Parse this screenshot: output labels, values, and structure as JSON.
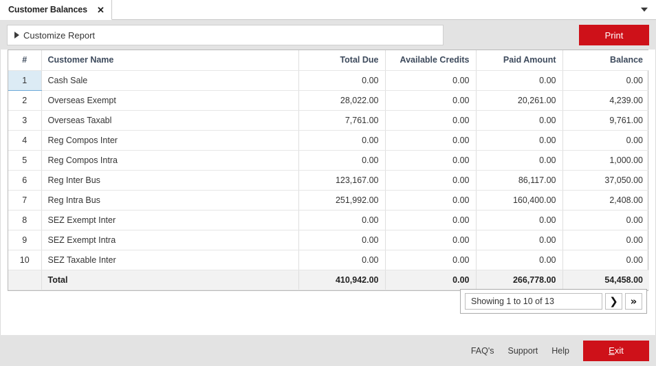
{
  "window": {
    "tab_title": "Customer Balances",
    "close_icon": "close-icon",
    "dropdown_icon": "chevron-down-icon"
  },
  "toolbar": {
    "customize_label": "Customize Report",
    "expand_icon": "triangle-right-icon",
    "print_label": "Print",
    "print_color": "#ce1119"
  },
  "table": {
    "columns": [
      "#",
      "Customer Name",
      "Total Due",
      "Available Credits",
      "Paid Amount",
      "Balance"
    ],
    "rows": [
      {
        "idx": "1",
        "name": "Cash Sale",
        "total_due": "0.00",
        "credits": "0.00",
        "paid": "0.00",
        "balance": "0.00",
        "selected": true
      },
      {
        "idx": "2",
        "name": "Overseas Exempt",
        "total_due": "28,022.00",
        "credits": "0.00",
        "paid": "20,261.00",
        "balance": "4,239.00",
        "selected": false
      },
      {
        "idx": "3",
        "name": "Overseas Taxabl",
        "total_due": "7,761.00",
        "credits": "0.00",
        "paid": "0.00",
        "balance": "9,761.00",
        "selected": false
      },
      {
        "idx": "4",
        "name": "Reg Compos Inter",
        "total_due": "0.00",
        "credits": "0.00",
        "paid": "0.00",
        "balance": "0.00",
        "selected": false
      },
      {
        "idx": "5",
        "name": "Reg Compos Intra",
        "total_due": "0.00",
        "credits": "0.00",
        "paid": "0.00",
        "balance": "1,000.00",
        "selected": false
      },
      {
        "idx": "6",
        "name": "Reg Inter Bus",
        "total_due": "123,167.00",
        "credits": "0.00",
        "paid": "86,117.00",
        "balance": "37,050.00",
        "selected": false
      },
      {
        "idx": "7",
        "name": "Reg Intra Bus",
        "total_due": "251,992.00",
        "credits": "0.00",
        "paid": "160,400.00",
        "balance": "2,408.00",
        "selected": false
      },
      {
        "idx": "8",
        "name": "SEZ Exempt Inter",
        "total_due": "0.00",
        "credits": "0.00",
        "paid": "0.00",
        "balance": "0.00",
        "selected": false
      },
      {
        "idx": "9",
        "name": "SEZ Exempt Intra",
        "total_due": "0.00",
        "credits": "0.00",
        "paid": "0.00",
        "balance": "0.00",
        "selected": false
      },
      {
        "idx": "10",
        "name": "SEZ Taxable Inter",
        "total_due": "0.00",
        "credits": "0.00",
        "paid": "0.00",
        "balance": "0.00",
        "selected": false
      }
    ],
    "total_row": {
      "label": "Total",
      "total_due": "410,942.00",
      "credits": "0.00",
      "paid": "266,778.00",
      "balance": "54,458.00"
    }
  },
  "pager": {
    "status": "Showing 1 to 10 of 13",
    "next_icon": "chevron-right-icon",
    "last_icon": "chevron-double-right-icon",
    "next_glyph": "❯",
    "last_glyph": "»"
  },
  "footer": {
    "links": [
      "FAQ's",
      "Support",
      "Help"
    ],
    "exit_label": "Exit",
    "exit_mnemonic": "E",
    "exit_rest": "xit",
    "exit_color": "#ce1119"
  }
}
